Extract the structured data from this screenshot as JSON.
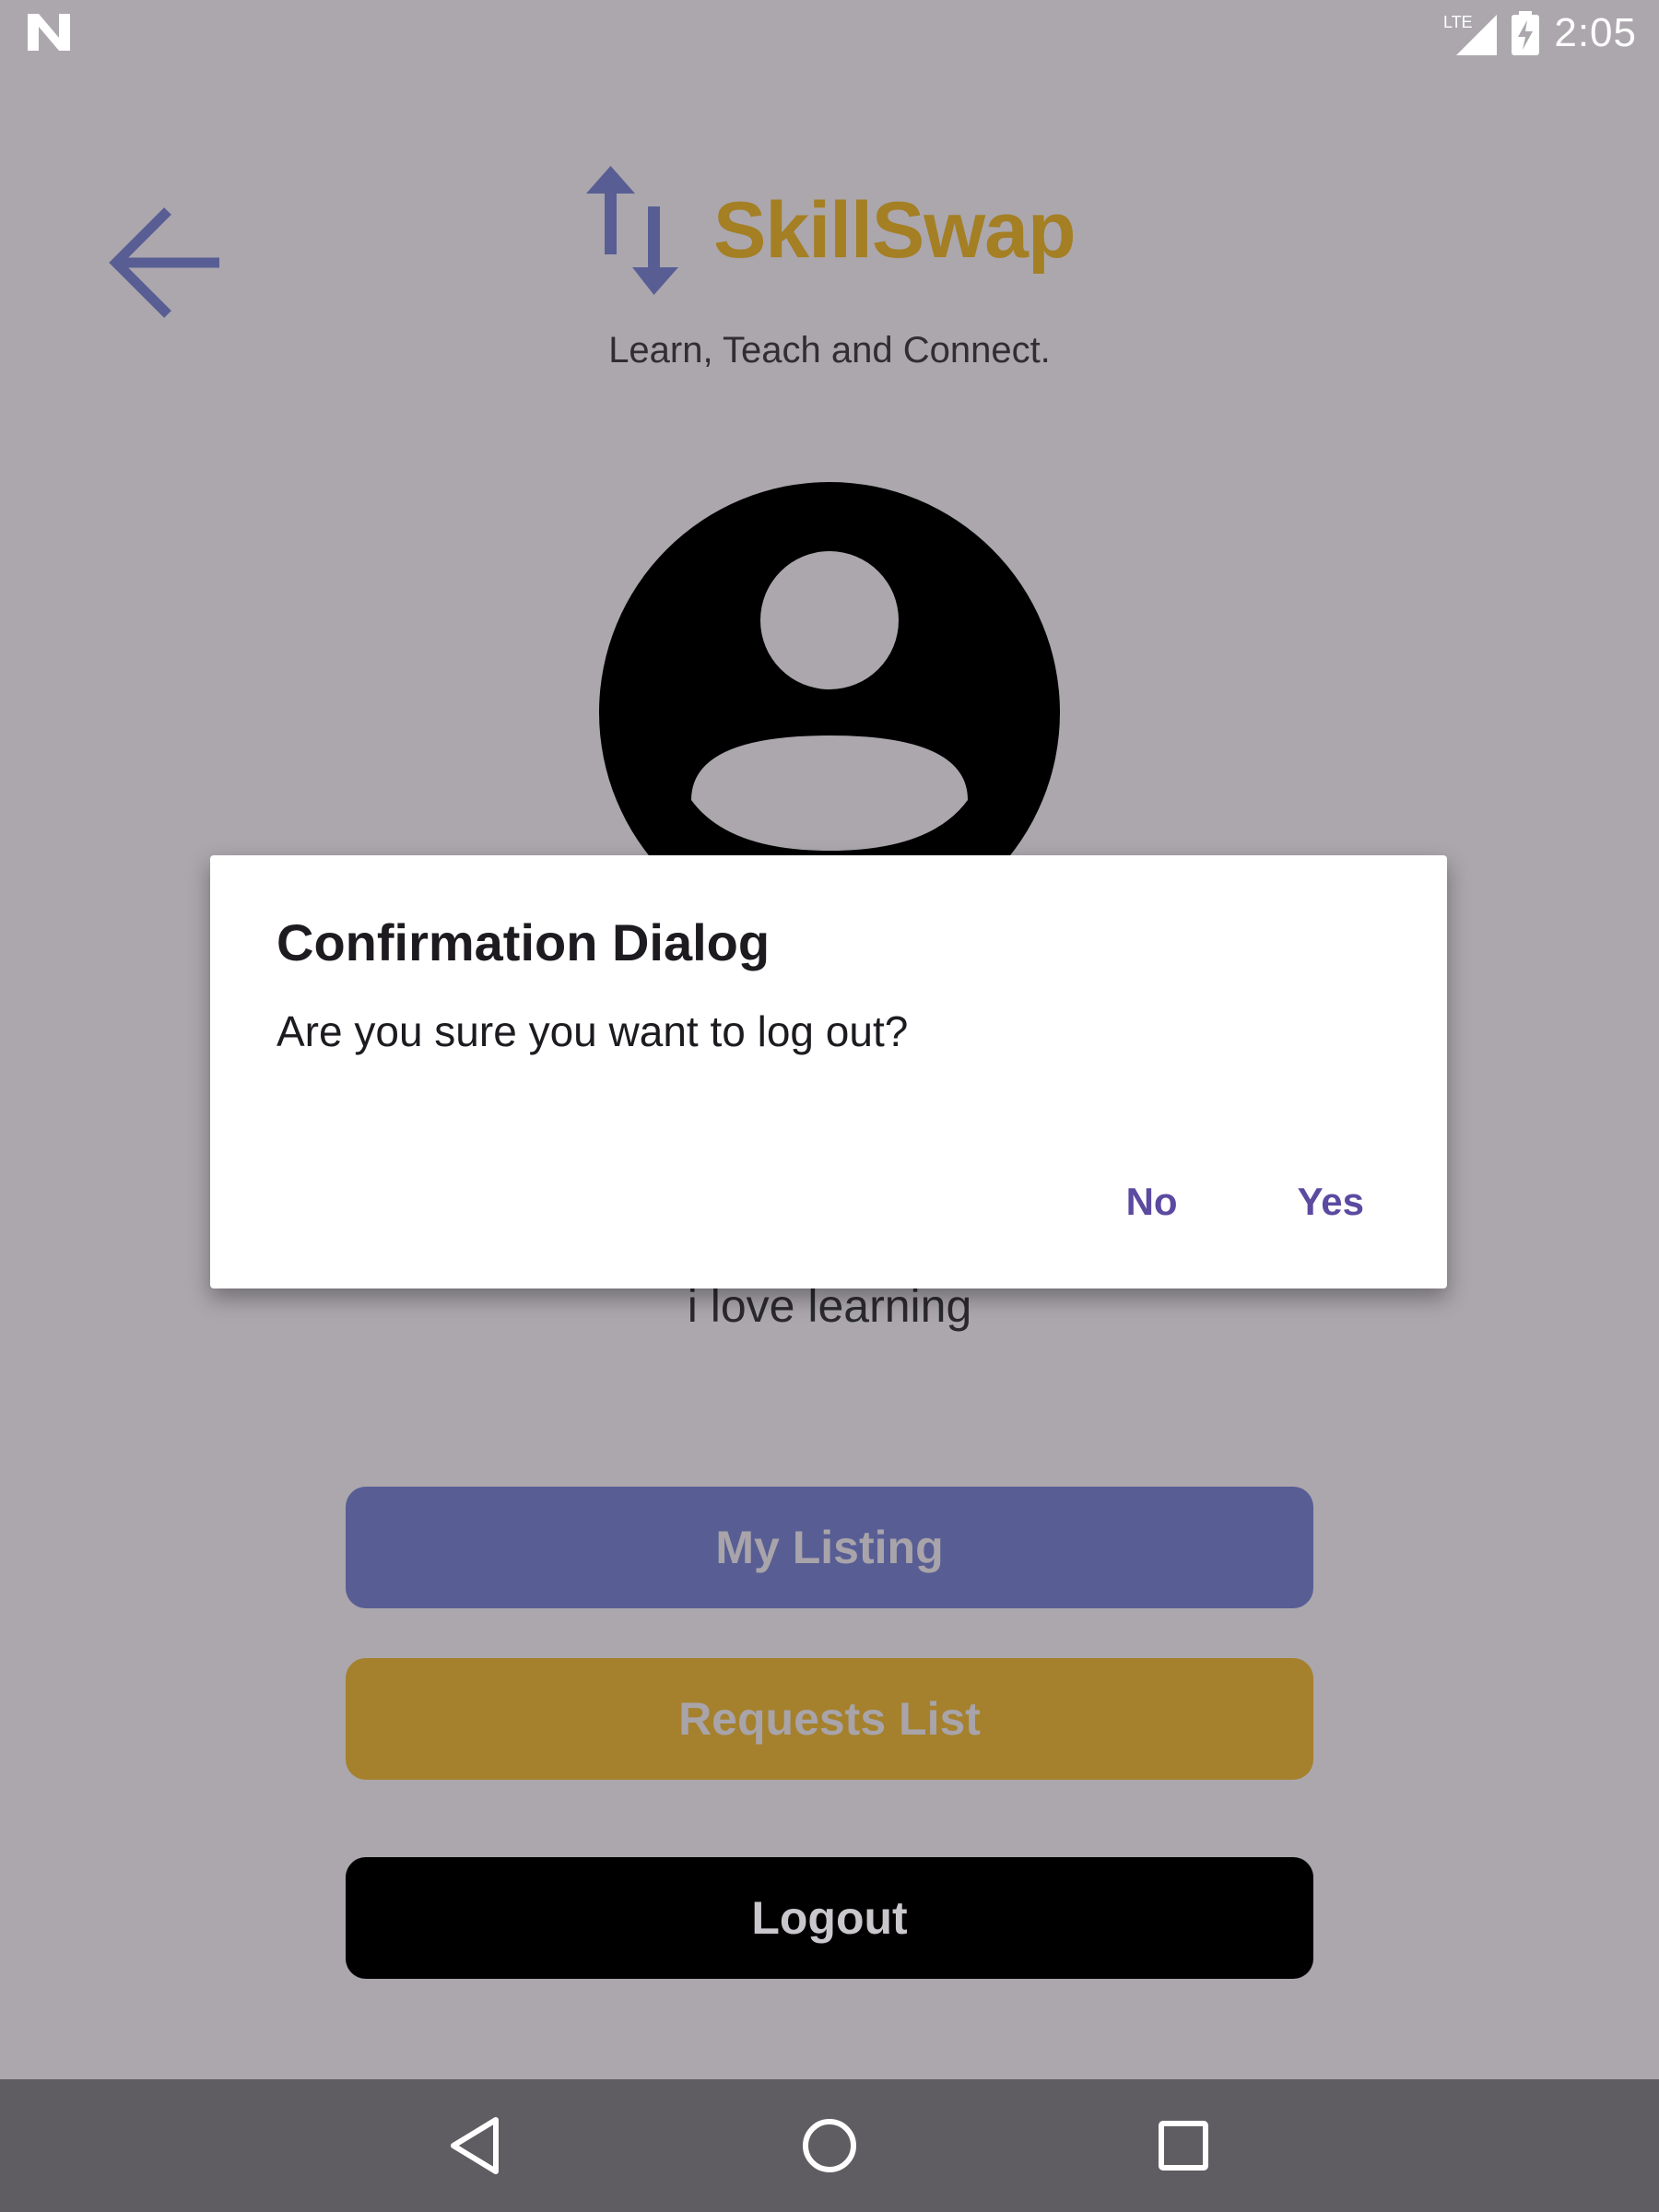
{
  "status_bar": {
    "network_label": "LTE",
    "time": "2:05"
  },
  "header": {
    "app_name": "SkillSwap",
    "tagline": "Learn, Teach and Connect."
  },
  "profile": {
    "bio": "i love learning"
  },
  "buttons": {
    "my_listing": "My Listing",
    "requests_list": "Requests List",
    "logout": "Logout"
  },
  "dialog": {
    "title": "Confirmation Dialog",
    "message": "Are you sure you want to log out?",
    "no_label": "No",
    "yes_label": "Yes"
  },
  "icons": {
    "back": "arrow-left-icon",
    "logo": "swap-arrows-icon",
    "avatar": "account-circle-icon",
    "nav_back": "triangle-back-icon",
    "nav_home": "circle-home-icon",
    "nav_recents": "square-recents-icon"
  },
  "colors": {
    "scrim_background": "#aba7ad",
    "brand_gold": "#a47f23",
    "brand_indigo": "#585e94",
    "dialog_accent": "#5c4aa1",
    "nav_bar": "#5f5d61"
  }
}
